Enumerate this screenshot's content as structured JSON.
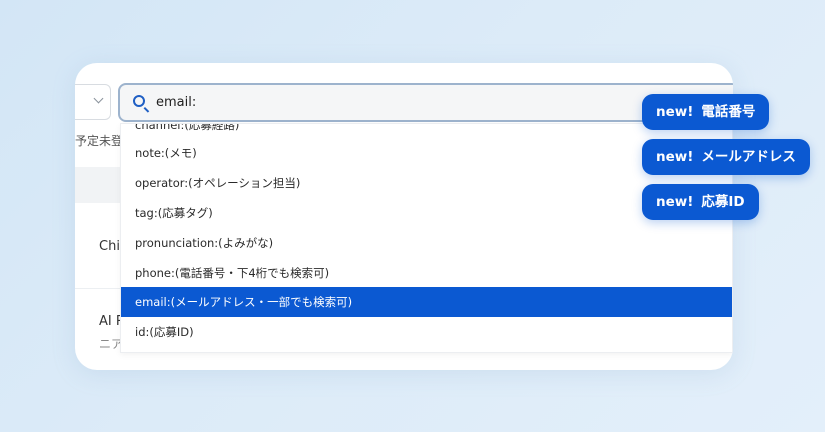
{
  "search": {
    "value": "email:",
    "placeholder": ""
  },
  "background_page": {
    "status_text": "予定未登録",
    "row1_text": "Chi",
    "row2_title": "AI R",
    "row2_sub": "ニア"
  },
  "dropdown": {
    "items": [
      {
        "label": "channel:(応募経路)"
      },
      {
        "label": "note:(メモ)"
      },
      {
        "label": "operator:(オペレーション担当)"
      },
      {
        "label": "tag:(応募タグ)"
      },
      {
        "label": "pronunciation:(よみがな)"
      },
      {
        "label": "phone:(電話番号・下4桁でも検索可)"
      },
      {
        "label": "email:(メールアドレス・一部でも検索可)"
      },
      {
        "label": "id:(応募ID)"
      }
    ],
    "selected_index": 6
  },
  "badges": [
    {
      "new": "new!",
      "label": "電話番号"
    },
    {
      "new": "new!",
      "label": "メールアドレス"
    },
    {
      "new": "new!",
      "label": "応募ID"
    }
  ],
  "colors": {
    "accent": "#0b59d2",
    "background": "#d8e9f7",
    "search_border": "#9db3cd"
  }
}
